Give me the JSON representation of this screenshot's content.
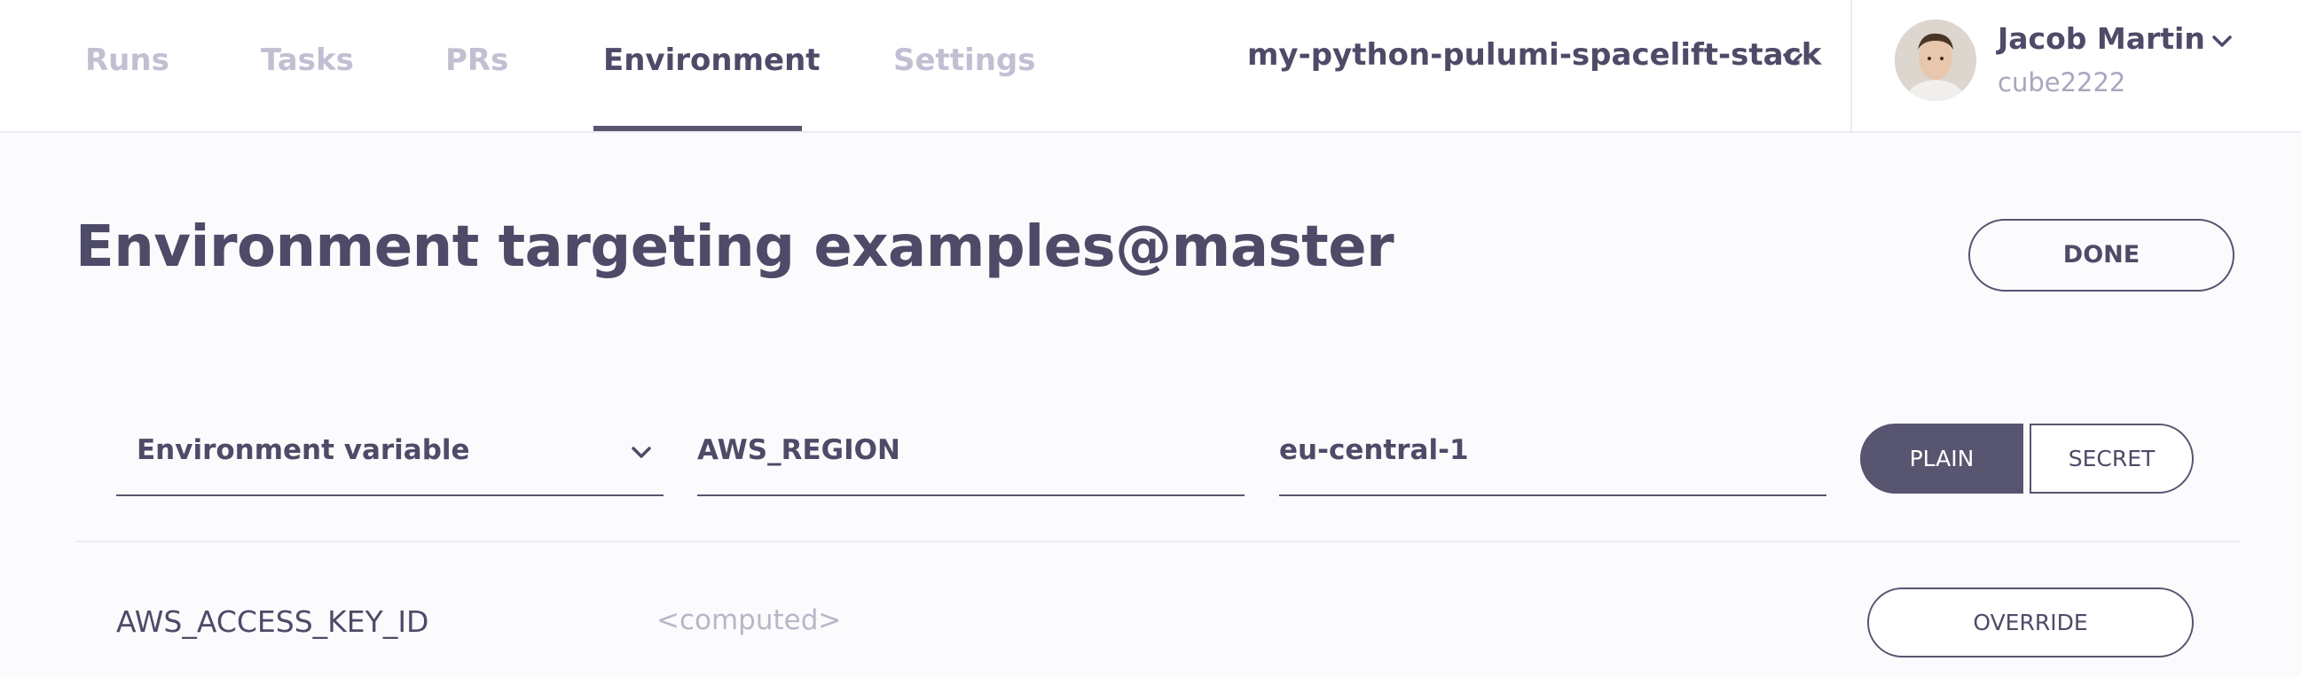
{
  "nav": {
    "tabs": [
      {
        "label": "Runs"
      },
      {
        "label": "Tasks"
      },
      {
        "label": "PRs"
      },
      {
        "label": "Environment"
      },
      {
        "label": "Settings"
      }
    ],
    "active_tab": "Environment",
    "stack_selector": "my-python-pulumi-spacelift-stack"
  },
  "user": {
    "name": "Jacob Martin",
    "handle": "cube2222"
  },
  "page": {
    "title": "Environment targeting examples@master",
    "done_label": "DONE"
  },
  "new_variable": {
    "type": "Environment variable",
    "key": "AWS_REGION",
    "value": "eu-central-1",
    "plain_label": "PLAIN",
    "secret_label": "SECRET",
    "selected_mode": "PLAIN"
  },
  "variables": [
    {
      "key": "AWS_ACCESS_KEY_ID",
      "value": "<computed>",
      "action_label": "OVERRIDE"
    }
  ],
  "colors": {
    "primary": "#57556f",
    "text": "#4d4b67",
    "muted": "#c2bfd2",
    "background": "#fbfbfd"
  }
}
